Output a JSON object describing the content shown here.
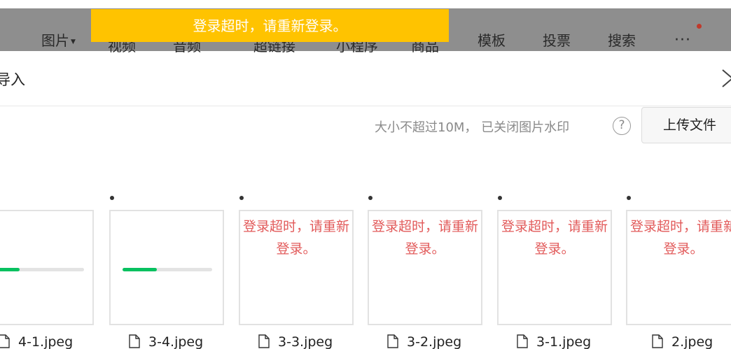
{
  "toolbar": {
    "items": [
      "图片",
      "视频",
      "音频",
      "超链接",
      "小程序",
      "商品",
      "模板",
      "投票",
      "搜索"
    ],
    "more_label": "···"
  },
  "toast": {
    "message": "登录超时，请重新登录。",
    "color": "#ffc300"
  },
  "dialog": {
    "title": "导入",
    "hint": "大小不超过10M， 已关闭图片水印",
    "help_label": "?",
    "upload_button": "上传文件"
  },
  "files": [
    {
      "name": "4-1.jpeg",
      "status": "uploading",
      "progress": 0.28
    },
    {
      "name": "3-4.jpeg",
      "status": "uploading",
      "progress": 0.38
    },
    {
      "name": "3-3.jpeg",
      "status": "error",
      "error": "登录超时，请重新登录。"
    },
    {
      "name": "3-2.jpeg",
      "status": "error",
      "error": "登录超时，请重新登录。"
    },
    {
      "name": "3-1.jpeg",
      "status": "error",
      "error": "登录超时，请重新登录。"
    },
    {
      "name": "2.jpeg",
      "status": "error",
      "error": "登录超时，请重新登录。"
    }
  ],
  "colors": {
    "progress": "#07c160",
    "error_text": "#e25a5a"
  }
}
